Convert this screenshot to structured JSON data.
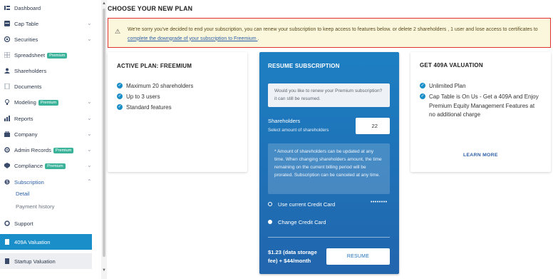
{
  "sidebar": {
    "items": [
      {
        "label": "Dashboard",
        "icon": "dashboard-icon"
      },
      {
        "label": "Cap Table",
        "icon": "cap-table-icon"
      },
      {
        "label": "Securities",
        "icon": "securities-icon"
      },
      {
        "label": "Spreadsheet",
        "badge": "Premium",
        "icon": "spreadsheet-icon"
      },
      {
        "label": "Shareholders",
        "icon": "shareholders-icon"
      },
      {
        "label": "Documents",
        "icon": "documents-icon"
      },
      {
        "label": "Modeling",
        "badge": "Premium",
        "icon": "modeling-icon"
      },
      {
        "label": "Reports",
        "icon": "reports-icon"
      },
      {
        "label": "Company",
        "icon": "company-icon"
      },
      {
        "label": "Admin Records",
        "badge": "Premium",
        "icon": "admin-records-icon"
      },
      {
        "label": "Compliance",
        "badge": "Premium",
        "icon": "compliance-icon"
      },
      {
        "label": "Subscription",
        "icon": "subscription-icon"
      },
      {
        "label": "Support",
        "icon": "support-icon"
      },
      {
        "label": "409A Valuation",
        "icon": "valuation-doc-icon"
      },
      {
        "label": "Startup Valuation",
        "icon": "startup-valuation-icon"
      }
    ],
    "subscription_sub": [
      "Detail",
      "Payment history"
    ]
  },
  "page": {
    "title": "CHOOSE YOUR NEW PLAN",
    "alert_text": "We're sorry you've decided to end your subscription, you can renew your subscription to keep access to features below. or delete 2 shareholders , 1 user and lose access to certificates to ",
    "alert_link": "complete the downgrade of your subscription to Freemium ",
    "alert_end": "."
  },
  "active_plan": {
    "title": "ACTIVE PLAN: FREEMIUM",
    "features": [
      "Maximum 20 shareholders",
      "Up to 3 users",
      "Standard features"
    ]
  },
  "resume": {
    "title": "RESUME SUBSCRIPTION",
    "question": "Would you like to renew your Premium subscription? it can still be resumed.",
    "shareholders_label": "Shareholders",
    "shareholders_sub": "Select amount of shareholders",
    "shareholders_value": "22",
    "info": "* Amount of shareholders can be updated at any time. When changing shareholders amount, the time remaining on the current billing period will be prorated. Subscription can be canceled at any time.",
    "option_current": "Use current Credit Card",
    "card_mask": "••••••••",
    "option_change": "Change Credit Card",
    "price": "$1.23 (data storage fee) + $44/month",
    "button": "RESUME"
  },
  "valuation": {
    "title": "GET 409A VALUATION",
    "features": [
      "Unlimited Plan",
      "Cap Table is On Us - Get a 409A and Enjoy Premium Equity Management Features at no additional charge"
    ],
    "learn_more": "LEARN MORE"
  },
  "colors": {
    "accent": "#1a8ec9",
    "badge": "#3bb39a",
    "alert_border": "#e03030",
    "alert_bg": "#fbf7dc"
  }
}
